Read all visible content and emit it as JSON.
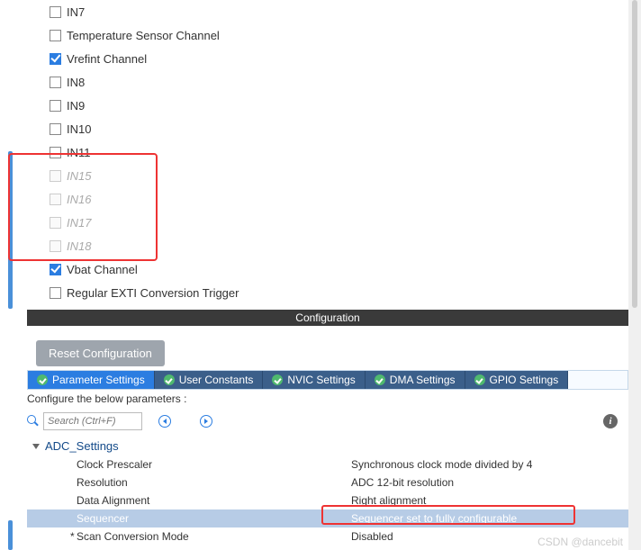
{
  "channels": [
    {
      "label": "IN7",
      "checked": false,
      "disabled": false
    },
    {
      "label": "Temperature Sensor Channel",
      "checked": false,
      "disabled": false
    },
    {
      "label": "Vrefint Channel",
      "checked": true,
      "disabled": false
    },
    {
      "label": "IN8",
      "checked": false,
      "disabled": false
    },
    {
      "label": "IN9",
      "checked": false,
      "disabled": false
    },
    {
      "label": "IN10",
      "checked": false,
      "disabled": false
    },
    {
      "label": "IN11",
      "checked": false,
      "disabled": false
    },
    {
      "label": "IN15",
      "checked": false,
      "disabled": true
    },
    {
      "label": "IN16",
      "checked": false,
      "disabled": true
    },
    {
      "label": "IN17",
      "checked": false,
      "disabled": true
    },
    {
      "label": "IN18",
      "checked": false,
      "disabled": true
    },
    {
      "label": "Vbat Channel",
      "checked": true,
      "disabled": false
    },
    {
      "label": "Regular EXTI Conversion Trigger",
      "checked": false,
      "disabled": false
    }
  ],
  "config_header": "Configuration",
  "reset_button": "Reset Configuration",
  "tabs": {
    "param": "Parameter Settings",
    "user": "User Constants",
    "nvic": "NVIC Settings",
    "dma": "DMA Settings",
    "gpio": "GPIO Settings"
  },
  "configure_text": "Configure the below parameters :",
  "search_placeholder": "Search (Ctrl+F)",
  "tree_title": "ADC_Settings",
  "params": [
    {
      "label": "Clock Prescaler",
      "value": "Synchronous clock mode divided by 4",
      "star": false,
      "hl": false
    },
    {
      "label": "Resolution",
      "value": "ADC 12-bit resolution",
      "star": false,
      "hl": false
    },
    {
      "label": "Data Alignment",
      "value": "Right alignment",
      "star": false,
      "hl": false
    },
    {
      "label": "Sequencer",
      "value": "Sequencer set to fully configurable",
      "star": false,
      "hl": true
    },
    {
      "label": "Scan Conversion Mode",
      "value": "Disabled",
      "star": true,
      "hl": false
    }
  ],
  "watermark": "CSDN @dancebit"
}
